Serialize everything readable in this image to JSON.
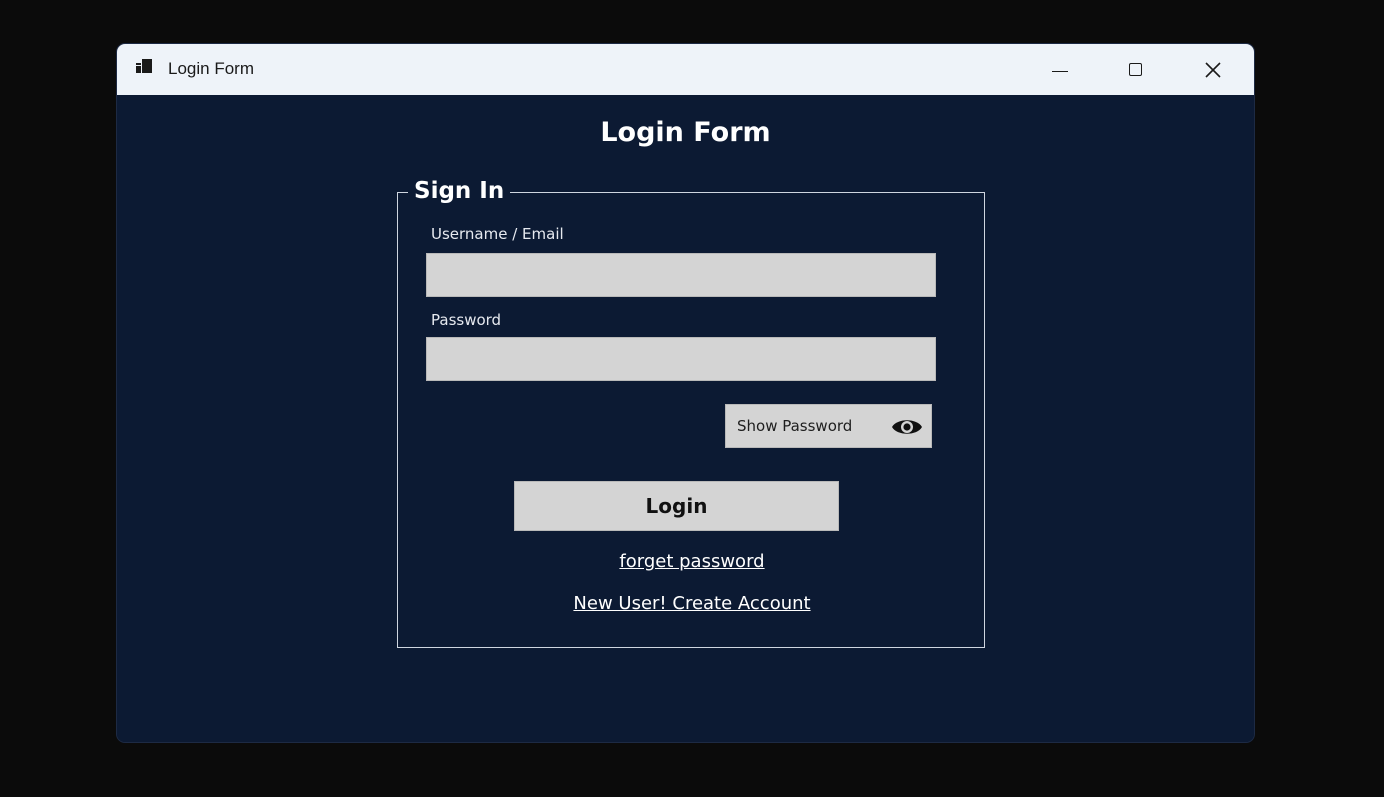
{
  "window": {
    "title": "Login Form",
    "icon": "app-icon",
    "controls": {
      "minimize": "minimize-icon",
      "maximize": "maximize-icon",
      "close": "close-icon"
    }
  },
  "form": {
    "heading": "Login Form",
    "group_title": "Sign In",
    "username": {
      "label": "Username / Email",
      "value": "",
      "placeholder": ""
    },
    "password": {
      "label": "Password",
      "value": "",
      "placeholder": ""
    },
    "show_password": {
      "label": "Show Password",
      "icon": "eye-icon"
    },
    "login_button": "Login",
    "forget_link": "forget password",
    "create_link": "New User! Create Account"
  },
  "colors": {
    "background": "#0c1a33",
    "titlebar": "#eef3f9",
    "control_bg": "#d4d4d4",
    "text_light": "#ffffff"
  }
}
